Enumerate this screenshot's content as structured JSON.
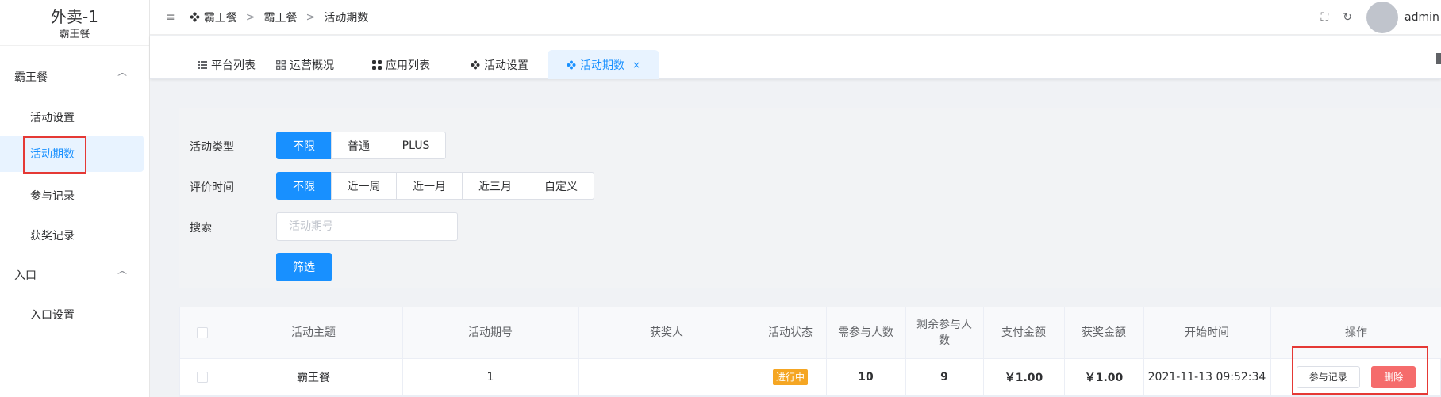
{
  "app": {
    "title": "外卖-1",
    "subtitle": "霸王餐"
  },
  "sidebar": {
    "groups": [
      {
        "label": "霸王餐",
        "items": [
          "活动设置",
          "活动期数",
          "参与记录",
          "获奖记录"
        ],
        "expanded": true
      },
      {
        "label": "入口",
        "items": [
          "入口设置"
        ],
        "expanded": true
      }
    ],
    "active_item": "活动期数"
  },
  "header": {
    "breadcrumbs": [
      "霸王餐",
      "霸王餐",
      "活动期数"
    ],
    "username": "admin"
  },
  "tabs": [
    {
      "label": "平台列表",
      "icon": "list-icon"
    },
    {
      "label": "运营概况",
      "icon": "grid-icon"
    },
    {
      "label": "应用列表",
      "icon": "apps-icon"
    },
    {
      "label": "活动设置",
      "icon": "flower-icon"
    },
    {
      "label": "活动期数",
      "icon": "flower-icon",
      "active": true
    }
  ],
  "filter": {
    "type_label": "活动类型",
    "type_options": [
      "不限",
      "普通",
      "PLUS"
    ],
    "type_selected": "不限",
    "time_label": "评价时间",
    "time_options": [
      "不限",
      "近一周",
      "近一月",
      "近三月",
      "自定义"
    ],
    "time_selected": "不限",
    "search_label": "搜索",
    "search_placeholder": "活动期号",
    "search_value": "",
    "submit_label": "筛选"
  },
  "table": {
    "columns": [
      "活动主题",
      "活动期号",
      "获奖人",
      "活动状态",
      "需参与人数",
      "剩余参与人数",
      "支付金额",
      "获奖金额",
      "开始时间",
      "操作"
    ],
    "rows": [
      {
        "theme": "霸王餐",
        "period": "1",
        "winner": "",
        "status": "进行中",
        "required": "10",
        "remaining": "9",
        "pay_amount": "￥1.00",
        "prize_amount": "￥1.00",
        "start_time": "2021-11-13 09:52:34",
        "actions": [
          "参与记录",
          "删除"
        ]
      }
    ]
  },
  "colors": {
    "primary": "#1890ff",
    "danger": "#f56c6c",
    "warning": "#f5a623",
    "highlight": "#e53935"
  }
}
